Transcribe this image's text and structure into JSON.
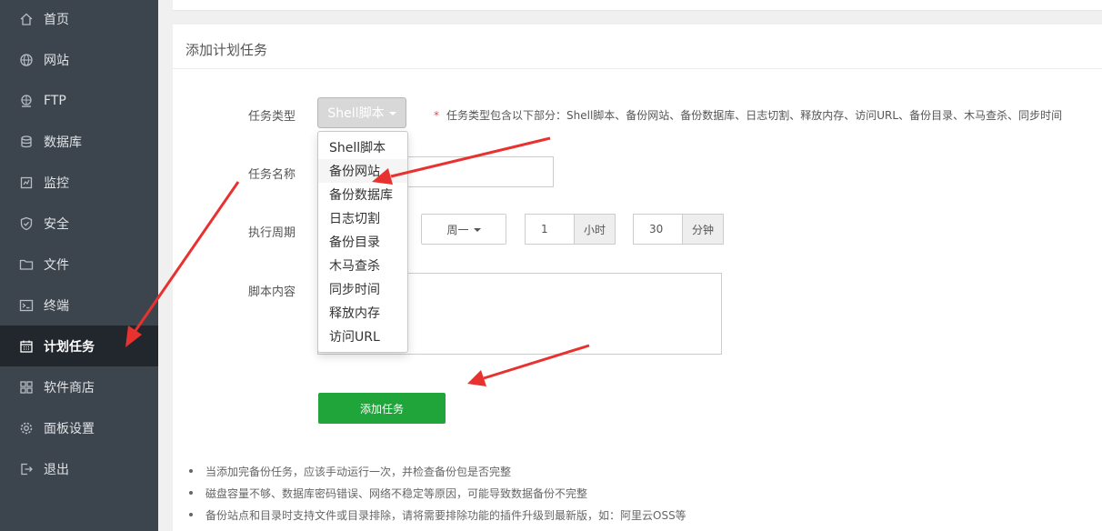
{
  "sidebar": {
    "items": [
      {
        "label": "首页",
        "icon": "home-icon"
      },
      {
        "label": "网站",
        "icon": "globe-icon"
      },
      {
        "label": "FTP",
        "icon": "ftp-globe-icon"
      },
      {
        "label": "数据库",
        "icon": "database-icon"
      },
      {
        "label": "监控",
        "icon": "monitor-icon"
      },
      {
        "label": "安全",
        "icon": "shield-icon"
      },
      {
        "label": "文件",
        "icon": "folder-icon"
      },
      {
        "label": "终端",
        "icon": "terminal-icon"
      },
      {
        "label": "计划任务",
        "icon": "calendar-icon",
        "active": true
      },
      {
        "label": "软件商店",
        "icon": "grid-icon"
      },
      {
        "label": "面板设置",
        "icon": "gear-icon"
      },
      {
        "label": "退出",
        "icon": "logout-icon"
      }
    ]
  },
  "panel": {
    "title": "添加计划任务"
  },
  "form": {
    "task_type_label": "任务类型",
    "task_type_value": "Shell脚本",
    "task_type_hint_star": "*",
    "task_type_hint": "任务类型包含以下部分：Shell脚本、备份网站、备份数据库、日志切割、释放内存、访问URL、备份目录、木马查杀、同步时间",
    "task_name_label": "任务名称",
    "period_label": "执行周期",
    "week_value": "周一",
    "hour_value": "1",
    "hour_unit": "小时",
    "minute_value": "30",
    "minute_unit": "分钟",
    "script_label": "脚本内容",
    "add_button": "添加任务"
  },
  "dropdown": {
    "options": [
      "Shell脚本",
      "备份网站",
      "备份数据库",
      "日志切割",
      "备份目录",
      "木马查杀",
      "同步时间",
      "释放内存",
      "访问URL"
    ],
    "highlighted": "备份网站"
  },
  "notes": [
    "当添加完备份任务，应该手动运行一次，并检查备份包是否完整",
    "磁盘容量不够、数据库密码错误、网络不稳定等原因，可能导致数据备份不完整",
    "备份站点和目录时支持文件或目录排除，请将需要排除功能的插件升级到最新版，如：阿里云OSS等"
  ],
  "colors": {
    "sidebar_bg": "#3c444d",
    "sidebar_active_bg": "#22272d",
    "accent_green": "#20a53a",
    "annotation_red": "#e8322f"
  }
}
